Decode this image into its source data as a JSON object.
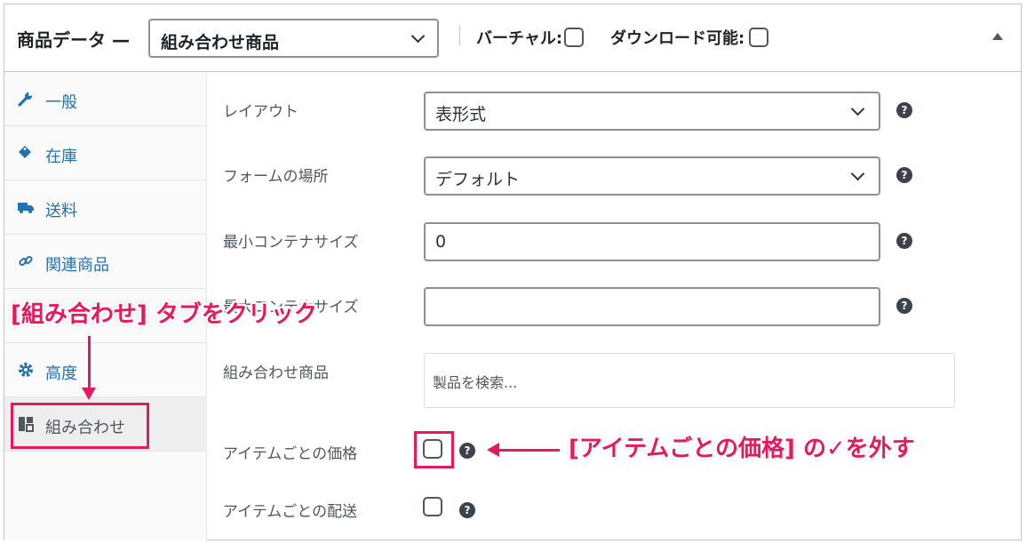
{
  "header": {
    "title": "商品データ —",
    "product_type": "組み合わせ商品",
    "virtual_label": "バーチャル:",
    "downloadable_label": "ダウンロード可能:"
  },
  "sidebar": {
    "items": [
      {
        "label": "一般",
        "icon": "wrench-icon"
      },
      {
        "label": "在庫",
        "icon": "tag-icon"
      },
      {
        "label": "送料",
        "icon": "truck-icon"
      },
      {
        "label": "関連商品",
        "icon": "link-icon"
      },
      {
        "label": "",
        "icon": "tag-icon"
      },
      {
        "label": "高度",
        "icon": "gear-icon"
      },
      {
        "label": "組み合わせ",
        "icon": "bundle-icon"
      }
    ],
    "active_index": 6
  },
  "fields": {
    "layout": {
      "label": "レイアウト",
      "value": "表形式"
    },
    "form_location": {
      "label": "フォームの場所",
      "value": "デフォルト"
    },
    "min_size": {
      "label": "最小コンテナサイズ",
      "value": "0"
    },
    "max_size": {
      "label": "最大コンテナサイズ",
      "value": ""
    },
    "bundled_products": {
      "label": "組み合わせ商品",
      "placeholder": "製品を検索..."
    },
    "per_item_price": {
      "label": "アイテムごとの価格",
      "checked": false
    },
    "per_item_shipping": {
      "label": "アイテムごとの配送",
      "checked": false
    }
  },
  "annotations": {
    "tab_callout": "[組み合わせ] タブをクリック",
    "price_callout": "[アイテムごとの価格] の✓を外す",
    "accent_color": "#e5195e"
  },
  "colors": {
    "link": "#2271b1",
    "border": "#8c8f94"
  }
}
